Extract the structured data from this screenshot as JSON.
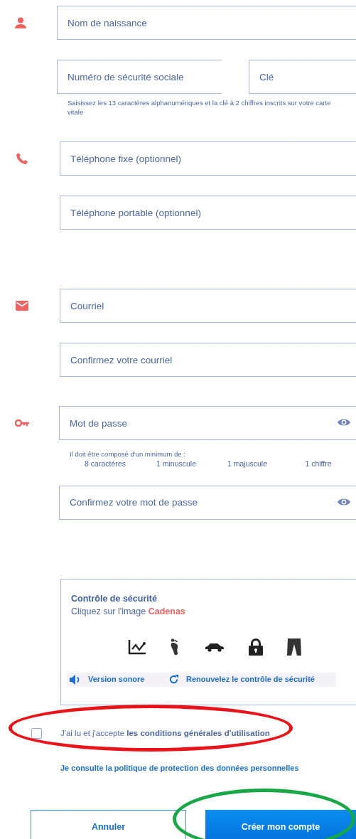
{
  "birth_name": {
    "placeholder": "Nom de naissance"
  },
  "social_security": {
    "number": {
      "placeholder": "Numéro de sécurité sociale"
    },
    "key": {
      "placeholder": "Clé"
    },
    "hint": "Saisissez les 13 caractères alphanumériques et la clé à 2 chiffres inscrits sur votre carte vitale"
  },
  "phones": {
    "fields": [
      {
        "placeholder": "Téléphone fixe (optionnel)"
      },
      {
        "placeholder": "Téléphone portable (optionnel)"
      }
    ]
  },
  "emails": {
    "fields": [
      {
        "placeholder": "Courriel"
      },
      {
        "placeholder": "Confirmez votre courriel"
      }
    ]
  },
  "password": {
    "placeholder": "Mot de passe",
    "reveal_toggle": true,
    "rules_title": "Il doit être composé d'un minimum de :",
    "rules": [
      "8 caractères",
      "1 minuscule",
      "1 majuscule",
      "1 chiffre"
    ]
  },
  "password_confirm": {
    "placeholder": "Confirmez votre mot de passe",
    "reveal_toggle": true
  },
  "security_check": {
    "title": "Contrôle de sécurité",
    "instruction": "Cliquez sur l'image",
    "target": "Cadenas",
    "images": [
      {
        "kind": "chart"
      },
      {
        "kind": "footprint"
      },
      {
        "kind": "car"
      },
      {
        "kind": "padlock"
      },
      {
        "kind": "trousers"
      }
    ],
    "audio_link": "Version sonore",
    "refresh_link": "Renouvelez le contrôle de sécurité"
  },
  "terms": {
    "checked": false,
    "text": "J'ai lu et j'accepte",
    "link": "les conditions générales d'utilisation"
  },
  "privacy_link": "Je consulte la politique de protection des données personnelles",
  "buttons": [
    {
      "kind": "secondary",
      "label": "Annuler"
    },
    {
      "kind": "primary",
      "label": "Créer mon compte"
    }
  ],
  "annotations": [
    {
      "kind": "ellipse",
      "color": "#e8141a"
    },
    {
      "kind": "ellipse",
      "color": "#1aa847"
    }
  ]
}
